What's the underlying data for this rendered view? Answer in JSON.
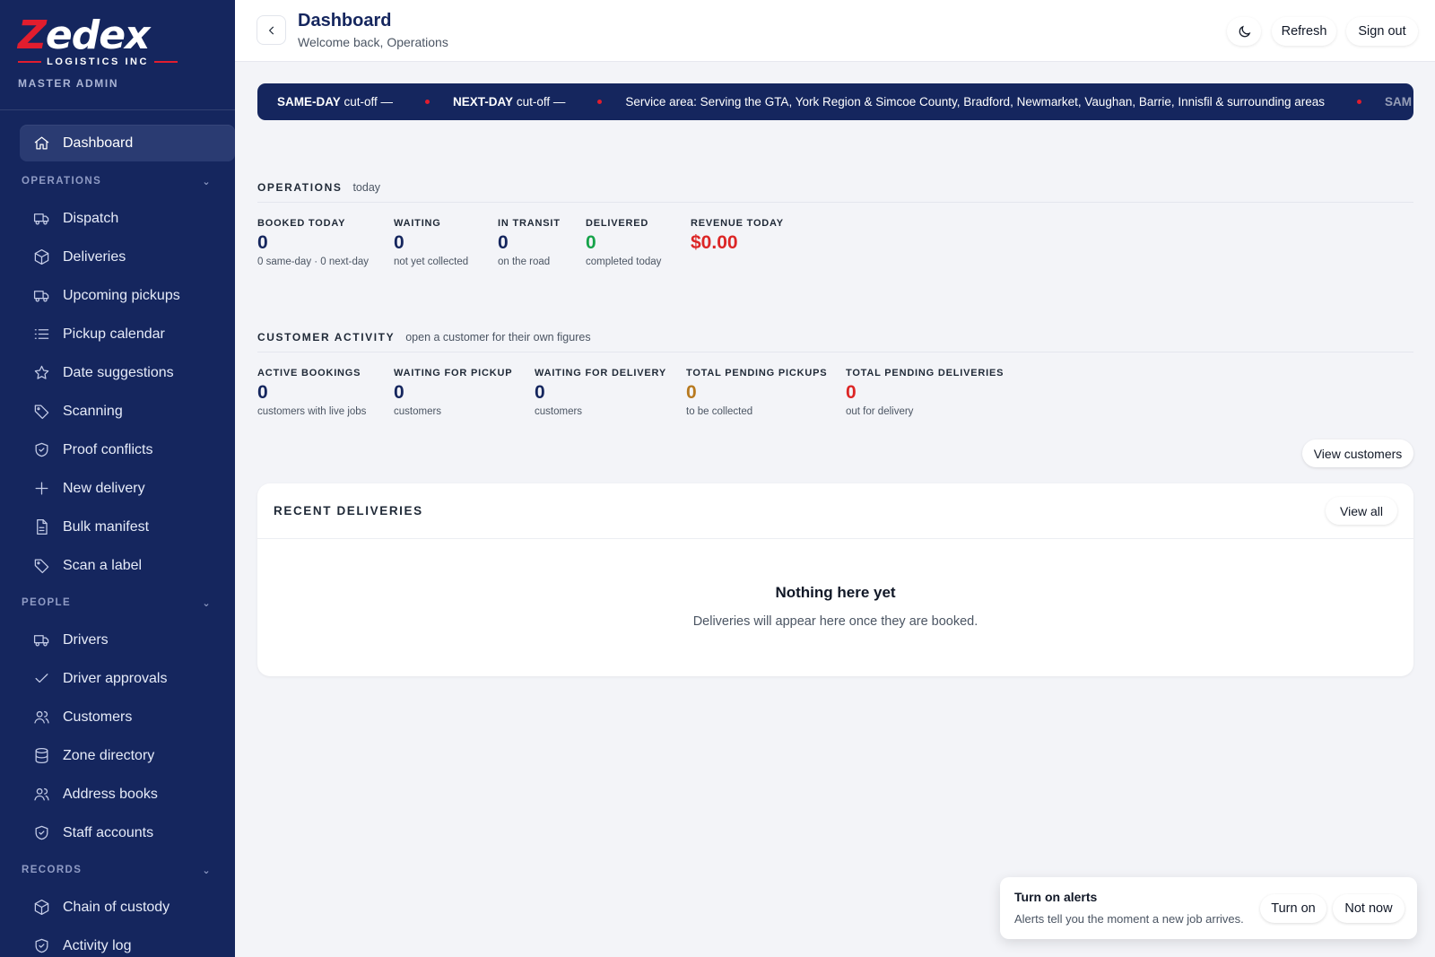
{
  "brand": {
    "logo_text_a": "Z",
    "logo_text_b": "edex",
    "logo_sub": "LOGISTICS INC",
    "role": "MASTER ADMIN"
  },
  "sidebar": {
    "dashboard": "Dashboard",
    "sections": {
      "operations": "OPERATIONS",
      "people": "PEOPLE",
      "records": "RECORDS"
    },
    "operations_items": [
      "Dispatch",
      "Deliveries",
      "Upcoming pickups",
      "Pickup calendar",
      "Date suggestions",
      "Scanning",
      "Proof conflicts",
      "New delivery",
      "Bulk manifest",
      "Scan a label"
    ],
    "people_items": [
      "Drivers",
      "Driver approvals",
      "Customers",
      "Zone directory",
      "Address books",
      "Staff accounts"
    ],
    "records_items": [
      "Chain of custody",
      "Activity log"
    ]
  },
  "header": {
    "title": "Dashboard",
    "subtitle": "Welcome back, Operations",
    "refresh": "Refresh",
    "sign_out": "Sign out"
  },
  "ticker": {
    "same_day_label": "SAME-DAY",
    "same_day_text": " cut-off —",
    "next_day_label": "NEXT-DAY",
    "next_day_text": " cut-off —",
    "service_area": "Service area: Serving the GTA, York Region & Simcoe County, Bradford, Newmarket, Vaughan, Barrie, Innisfil & surrounding areas",
    "repeat": "SAM"
  },
  "operations": {
    "title": "OPERATIONS",
    "note": "today",
    "stats": [
      {
        "label": "BOOKED TODAY",
        "value": "0",
        "sub": "0 same-day · 0 next-day"
      },
      {
        "label": "WAITING",
        "value": "0",
        "sub": "not yet collected"
      },
      {
        "label": "IN TRANSIT",
        "value": "0",
        "sub": "on the road"
      },
      {
        "label": "DELIVERED",
        "value": "0",
        "sub": "completed today"
      },
      {
        "label": "REVENUE TODAY",
        "value": "$0.00",
        "sub": ""
      }
    ]
  },
  "customer_activity": {
    "title": "CUSTOMER ACTIVITY",
    "note": "open a customer for their own figures",
    "stats": [
      {
        "label": "ACTIVE BOOKINGS",
        "value": "0",
        "sub": "customers with live jobs"
      },
      {
        "label": "WAITING FOR PICKUP",
        "value": "0",
        "sub": "customers"
      },
      {
        "label": "WAITING FOR DELIVERY",
        "value": "0",
        "sub": "customers"
      },
      {
        "label": "TOTAL PENDING PICKUPS",
        "value": "0",
        "sub": "to be collected"
      },
      {
        "label": "TOTAL PENDING DELIVERIES",
        "value": "0",
        "sub": "out for delivery"
      }
    ],
    "view_customers": "View customers"
  },
  "recent": {
    "title": "RECENT DELIVERIES",
    "view_all": "View all",
    "empty_title": "Nothing here yet",
    "empty_sub": "Deliveries will appear here once they are booked."
  },
  "toast": {
    "title": "Turn on alerts",
    "sub": "Alerts tell you the moment a new job arrives.",
    "turn_on": "Turn on",
    "not_now": "Not now"
  },
  "colors": {
    "navy": "#15265e",
    "brand_red": "#e11d2e",
    "delivered_green": "#16a34a",
    "revenue_red": "#dc2626",
    "pending_pickups_amber": "#b7791f"
  }
}
